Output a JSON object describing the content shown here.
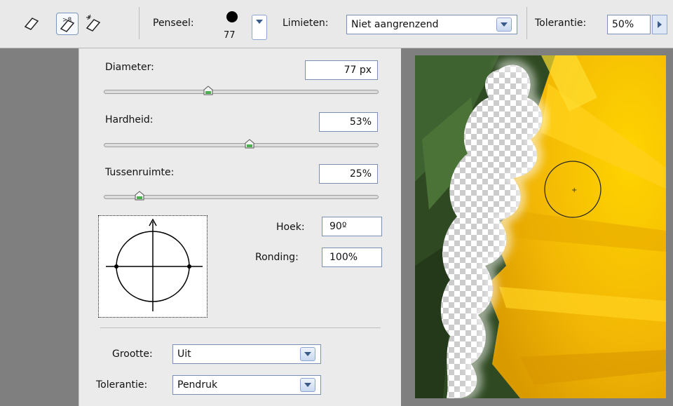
{
  "toolbar": {
    "tools": [
      {
        "name": "eraser-tool-icon",
        "active": false
      },
      {
        "name": "background-eraser-tool-icon",
        "active": true
      },
      {
        "name": "magic-eraser-tool-icon",
        "active": false
      }
    ],
    "brush_label": "Penseel:",
    "brush_size": "77",
    "limits_label": "Limieten:",
    "limits_value": "Niet aangrenzend",
    "tolerance_label": "Tolerantie:",
    "tolerance_value": "50%"
  },
  "brush_panel": {
    "diameter_label": "Diameter:",
    "diameter_value": "77 px",
    "diameter_slider": 0.38,
    "hardness_label": "Hardheid:",
    "hardness_value": "53%",
    "hardness_slider": 0.53,
    "spacing_label": "Tussenruimte:",
    "spacing_value": "25%",
    "spacing_slider": 0.13,
    "angle_label": "Hoek:",
    "angle_value": "90º",
    "roundness_label": "Ronding:",
    "roundness_value": "100%",
    "size_label": "Grootte:",
    "size_value": "Uit",
    "tolerance_label": "Tolerantie:",
    "tolerance_value": "Pendruk"
  },
  "colors": {
    "accent_border": "#7a8fb4",
    "slider_thumb": "#3c9a3c",
    "petal_yellow": "#f2b705",
    "leaf_green": "#2f4a22"
  }
}
